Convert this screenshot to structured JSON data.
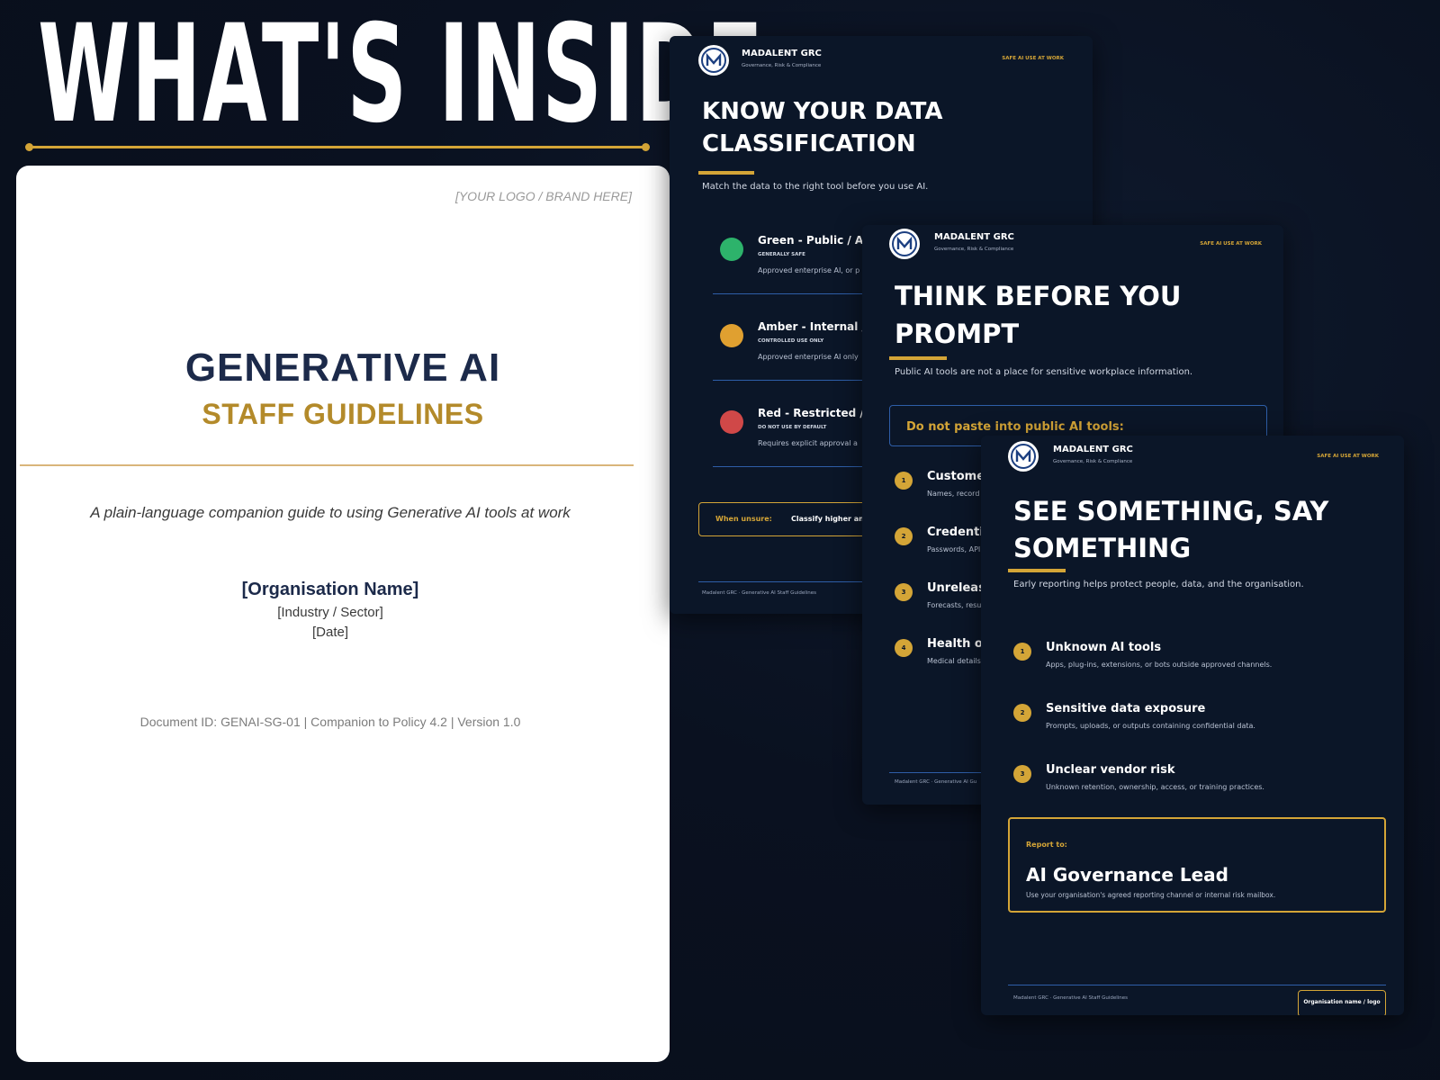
{
  "headline": "WHAT'S INSIDE",
  "cover": {
    "logo_placeholder": "[YOUR LOGO / BRAND HERE]",
    "title": "GENERATIVE AI",
    "subtitle": "STAFF GUIDELINES",
    "tagline": "A plain-language companion guide to using Generative AI tools at work",
    "organisation": "[Organisation Name]",
    "sector": "[Industry / Sector]",
    "date": "[Date]",
    "doc_id": "Document ID: GENAI-SG-01  |  Companion to Policy 4.2  |  Version 1.0"
  },
  "brand": {
    "name": "MADALENT GRC",
    "sub": "Governance, Risk & Compliance",
    "topline": "SAFE AI USE AT WORK",
    "footer": "Madalent GRC · Generative AI Staff Guidelines"
  },
  "card1": {
    "title_line1": "KNOW YOUR DATA",
    "title_line2": "CLASSIFICATION",
    "lead": "Match the data to the right tool before you use AI.",
    "rows": [
      {
        "title": "Green - Public / Ap",
        "tag": "GENERALLY SAFE",
        "desc": "Approved enterprise AI, or p",
        "color": "#2db36b"
      },
      {
        "title": "Amber - Internal /",
        "tag": "CONTROLLED USE ONLY",
        "desc": "Approved enterprise AI only",
        "color": "#e0a030"
      },
      {
        "title": "Red - Restricted / F",
        "tag": "DO NOT USE BY DEFAULT",
        "desc": "Requires explicit approval a",
        "color": "#d04848"
      }
    ],
    "unsure_label": "When unsure:",
    "unsure_text": "Classify higher and"
  },
  "card2": {
    "title_line1": "THINK BEFORE YOU",
    "title_line2": "PROMPT",
    "lead": "Public AI tools are not a place for sensitive workplace information.",
    "box_title": "Do not paste into public AI tools:",
    "items": [
      {
        "num": "1",
        "title": "Customer",
        "desc": "Names, record"
      },
      {
        "num": "2",
        "title": "Credentia",
        "desc": "Passwords, API"
      },
      {
        "num": "3",
        "title": "Unrelease",
        "desc": "Forecasts, resu"
      },
      {
        "num": "4",
        "title": "Health or",
        "desc": "Medical details"
      }
    ],
    "footer": "Madalent GRC · Generative AI Gu"
  },
  "card3": {
    "title_line1": "SEE SOMETHING, SAY",
    "title_line2": "SOMETHING",
    "lead": "Early reporting helps protect people, data, and the organisation.",
    "items": [
      {
        "num": "1",
        "title": "Unknown AI tools",
        "desc": "Apps, plug-ins, extensions, or bots outside approved channels."
      },
      {
        "num": "2",
        "title": "Sensitive data exposure",
        "desc": "Prompts, uploads, or outputs containing confidential data."
      },
      {
        "num": "3",
        "title": "Unclear vendor risk",
        "desc": "Unknown retention, ownership, access, or training practices."
      }
    ],
    "report_label": "Report to:",
    "report_title": "AI Governance Lead",
    "report_desc": "Use your organisation's agreed reporting channel or internal risk mailbox.",
    "org_chip": "Organisation name / logo"
  }
}
